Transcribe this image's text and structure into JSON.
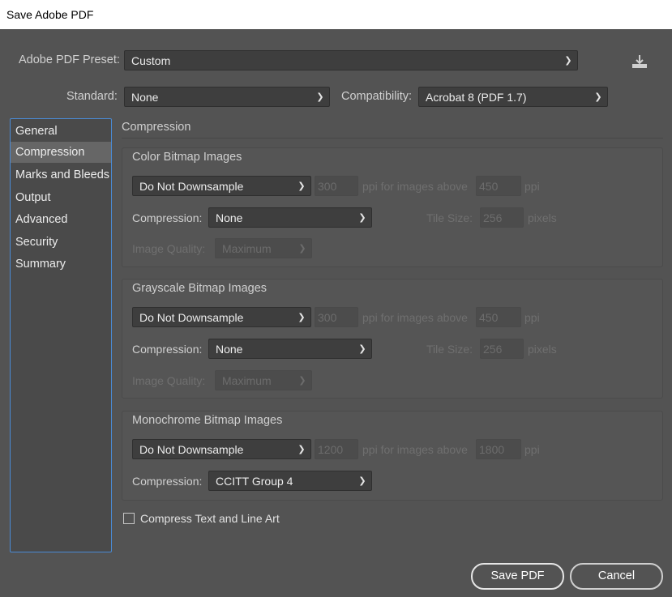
{
  "window": {
    "title": "Save Adobe PDF"
  },
  "preset": {
    "label": "Adobe PDF Preset:",
    "value": "Custom",
    "icon": "save-preset-icon"
  },
  "standard": {
    "label": "Standard:",
    "value": "None"
  },
  "compatibility": {
    "label": "Compatibility:",
    "value": "Acrobat 8 (PDF 1.7)"
  },
  "sidebar": {
    "items": [
      {
        "label": "General"
      },
      {
        "label": "Compression",
        "active": true
      },
      {
        "label": "Marks and Bleeds"
      },
      {
        "label": "Output"
      },
      {
        "label": "Advanced"
      },
      {
        "label": "Security"
      },
      {
        "label": "Summary"
      }
    ]
  },
  "panel": {
    "title": "Compression",
    "color": {
      "title": "Color Bitmap Images",
      "downsample": "Do Not Downsample",
      "ppi": "300",
      "above_label": "ppi for images above",
      "above": "450",
      "ppi_unit": "ppi",
      "compression_label": "Compression:",
      "compression": "None",
      "tile_label": "Tile Size:",
      "tile": "256",
      "tile_unit": "pixels",
      "quality_label": "Image Quality:",
      "quality": "Maximum"
    },
    "grayscale": {
      "title": "Grayscale Bitmap Images",
      "downsample": "Do Not Downsample",
      "ppi": "300",
      "above_label": "ppi for images above",
      "above": "450",
      "ppi_unit": "ppi",
      "compression_label": "Compression:",
      "compression": "None",
      "tile_label": "Tile Size:",
      "tile": "256",
      "tile_unit": "pixels",
      "quality_label": "Image Quality:",
      "quality": "Maximum"
    },
    "mono": {
      "title": "Monochrome Bitmap Images",
      "downsample": "Do Not Downsample",
      "ppi": "1200",
      "above_label": "ppi for images above",
      "above": "1800",
      "ppi_unit": "ppi",
      "compression_label": "Compression:",
      "compression": "CCITT Group 4"
    },
    "compress_text": {
      "label": "Compress Text and Line Art",
      "checked": false
    }
  },
  "buttons": {
    "save": "Save PDF",
    "cancel": "Cancel"
  },
  "colors": {
    "background": "#535353",
    "sidebar_border": "#4a8bd6",
    "active_item": "#666666"
  }
}
